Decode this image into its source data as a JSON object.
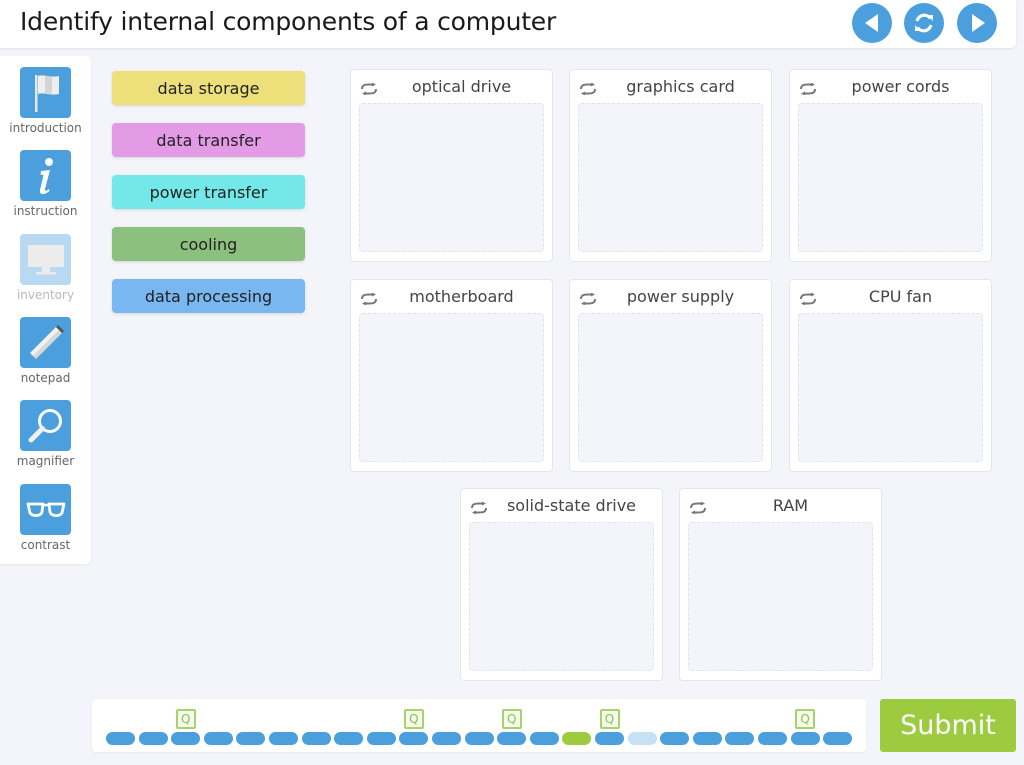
{
  "header": {
    "title": "Identify internal components of a computer",
    "nav": [
      {
        "name": "previous-button",
        "icon": "arrow-left-icon"
      },
      {
        "name": "reset-button",
        "icon": "refresh-icon"
      },
      {
        "name": "next-button",
        "icon": "arrow-right-icon"
      }
    ]
  },
  "sidebar": {
    "tools": [
      {
        "label": "introduction",
        "icon": "flag-icon",
        "enabled": true
      },
      {
        "label": "instruction",
        "icon": "info-icon",
        "enabled": true
      },
      {
        "label": "inventory",
        "icon": "monitor-icon",
        "enabled": false
      },
      {
        "label": "notepad",
        "icon": "pencil-icon",
        "enabled": true
      },
      {
        "label": "magnifier",
        "icon": "magnifier-icon",
        "enabled": true
      },
      {
        "label": "contrast",
        "icon": "glasses-icon",
        "enabled": true
      }
    ]
  },
  "chips": [
    {
      "label": "data storage",
      "color": "#eddf79"
    },
    {
      "label": "data transfer",
      "color": "#e39be6"
    },
    {
      "label": "power transfer",
      "color": "#74e8e8"
    },
    {
      "label": "cooling",
      "color": "#8cc07e"
    },
    {
      "label": "data processing",
      "color": "#78b7f0"
    }
  ],
  "cards": [
    {
      "label": "optical drive"
    },
    {
      "label": "graphics card"
    },
    {
      "label": "power cords"
    },
    {
      "label": "motherboard"
    },
    {
      "label": "power supply"
    },
    {
      "label": "CPU fan"
    },
    {
      "label": "solid-state drive"
    },
    {
      "label": "RAM"
    }
  ],
  "progress": {
    "total": 23,
    "current_index": 14,
    "unvisited_indices": [
      16
    ],
    "question_marker_indices": [
      2,
      9,
      12,
      15,
      21
    ],
    "marker_label": "Q",
    "colors": {
      "done": "#4a9fdc",
      "current": "#9ccb3f",
      "unvisited": "#c7e1f4"
    }
  },
  "submit": {
    "label": "Submit"
  }
}
